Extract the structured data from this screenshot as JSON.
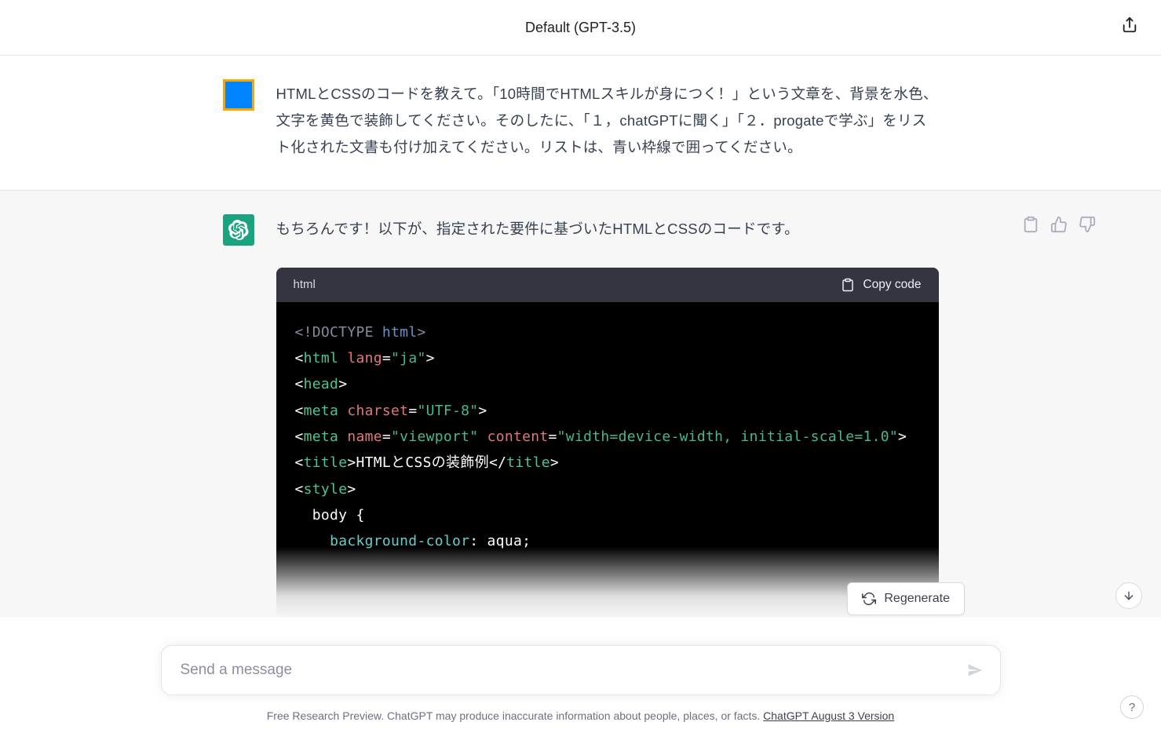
{
  "header": {
    "model_title": "Default (GPT-3.5)"
  },
  "conversation": {
    "user_message": "HTMLとCSSのコードを教えて。「10時間でHTMLスキルが身につく！」という文章を、背景を水色、文字を黄色で装飾してください。そのしたに、「１，chatGPTに聞く」「２．progateで学ぶ」をリスト化された文書も付け加えてください。リストは、青い枠線で囲ってください。",
    "assistant_intro": "もちろんです！以下が、指定された要件に基づいたHTMLとCSSのコードです。",
    "code": {
      "language_label": "html",
      "copy_label": "Copy code",
      "tokens": {
        "l1_doctype": "<!DOCTYPE ",
        "l1_html": "html",
        "l1_close": ">",
        "l2_open": "<",
        "l2_tag": "html",
        "l2_sp": " ",
        "l2_attr": "lang",
        "l2_eq": "=",
        "l2_val": "\"ja\"",
        "l2_close": ">",
        "l3_open": "<",
        "l3_tag": "head",
        "l3_close": ">",
        "l4_open": "<",
        "l4_tag": "meta",
        "l4_sp": " ",
        "l4_attr": "charset",
        "l4_eq": "=",
        "l4_val": "\"UTF-8\"",
        "l4_close": ">",
        "l5_open": "<",
        "l5_tag": "meta",
        "l5_sp": " ",
        "l5_attr1": "name",
        "l5_eq1": "=",
        "l5_val1": "\"viewport\"",
        "l5_sp2": " ",
        "l5_attr2": "content",
        "l5_eq2": "=",
        "l5_val2": "\"width=device-width, initial-scale=1.0\"",
        "l5_close": ">",
        "l6_open": "<",
        "l6_tag": "title",
        "l6_close": ">",
        "l6_text": "HTMLとCSSの装飾例",
        "l6_open2": "</",
        "l6_tag2": "title",
        "l6_close2": ">",
        "l7_open": "<",
        "l7_tag": "style",
        "l7_close": ">",
        "l8_sel": "  body {",
        "l9_indent": "    ",
        "l9_prop": "background-color",
        "l9_colon": ": aqua;"
      }
    }
  },
  "controls": {
    "regenerate_label": "Regenerate"
  },
  "input": {
    "placeholder": "Send a message"
  },
  "footer": {
    "disclaimer_prefix": "Free Research Preview. ChatGPT may produce inaccurate information about people, places, or facts. ",
    "version_link": "ChatGPT August 3 Version"
  },
  "help": {
    "label": "?"
  }
}
